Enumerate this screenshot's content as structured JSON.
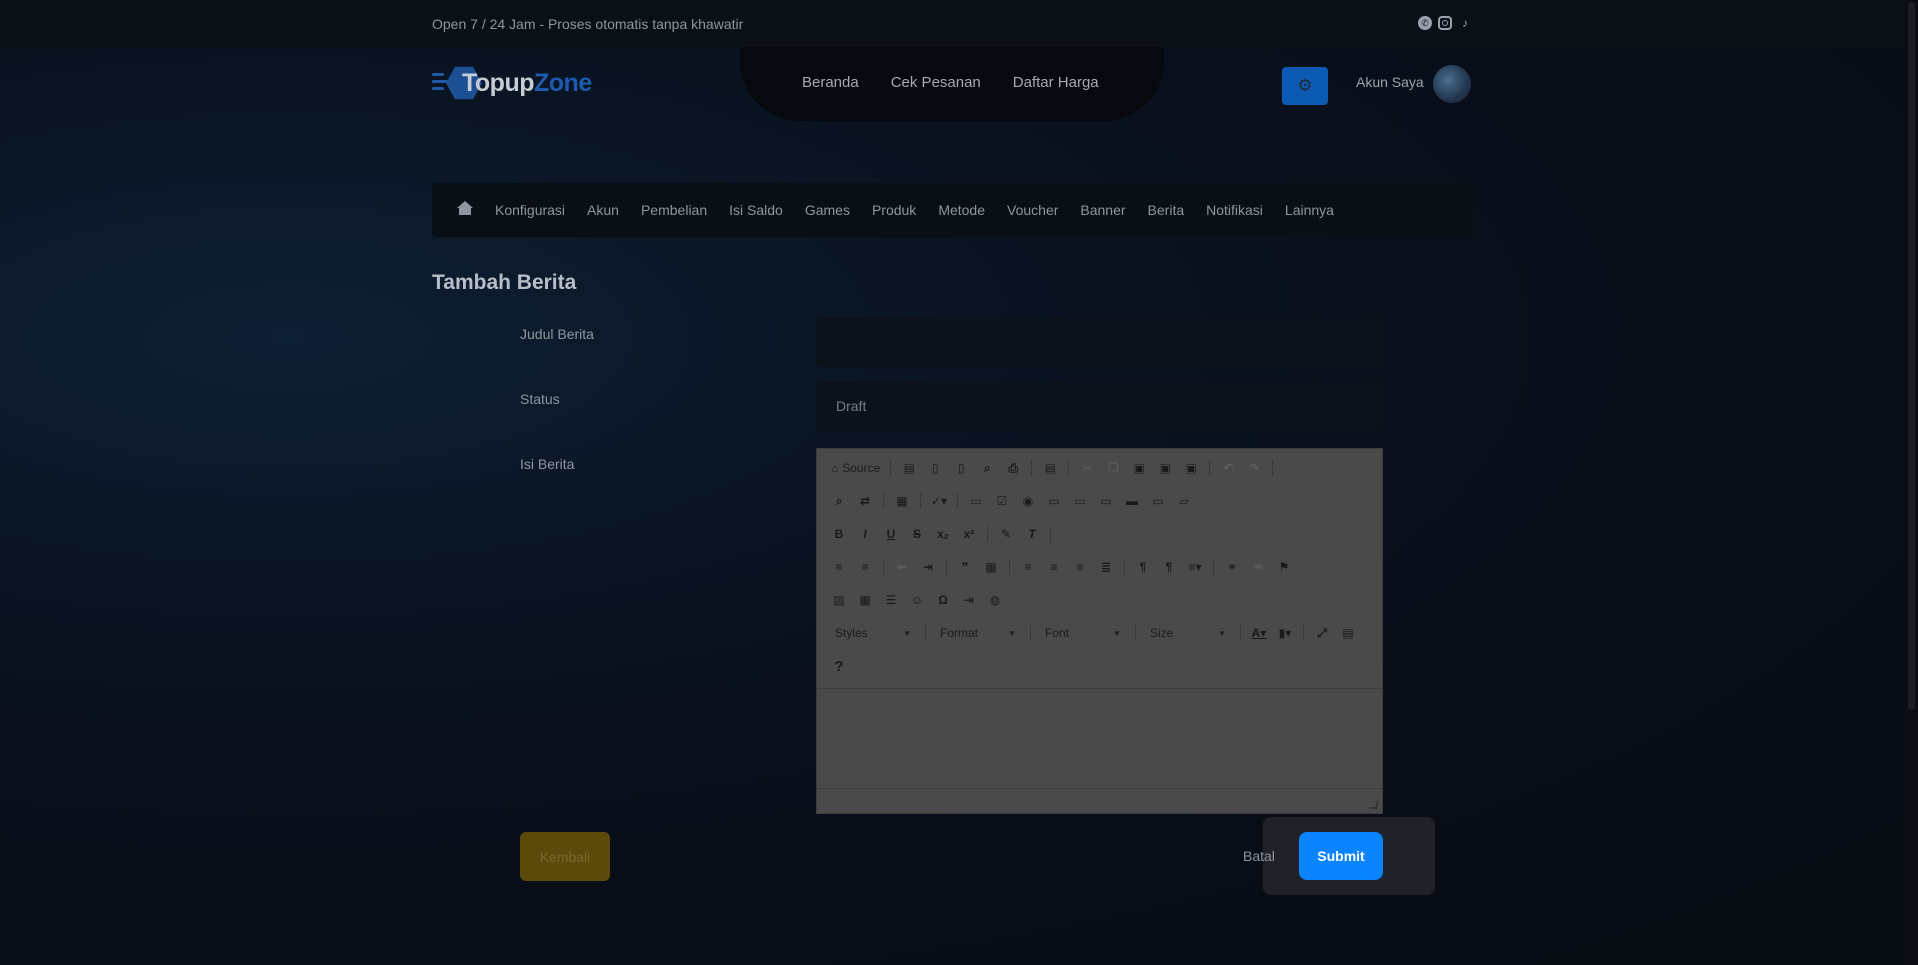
{
  "topbar": {
    "tagline": "Open 7 / 24 Jam - Proses otomatis tanpa khawatir",
    "socials": [
      "whatsapp-icon",
      "instagram-icon",
      "tiktok-icon"
    ]
  },
  "header": {
    "logo_part1": "Topup",
    "logo_part2": "Zone",
    "nav": [
      "Beranda",
      "Cek Pesanan",
      "Daftar Harga"
    ],
    "settings_icon": "gear-icon",
    "account_label": "Akun Saya"
  },
  "admin_menu": {
    "home_icon": "home-icon",
    "items": [
      "Konfigurasi",
      "Akun",
      "Pembelian",
      "Isi Saldo",
      "Games",
      "Produk",
      "Metode",
      "Voucher",
      "Banner",
      "Berita",
      "Notifikasi",
      "Lainnya"
    ]
  },
  "form": {
    "title": "Tambah Berita",
    "judul_label": "Judul Berita",
    "judul_value": "",
    "status_label": "Status",
    "status_value": "Draft",
    "isi_label": "Isi Berita"
  },
  "editor": {
    "source_label": "Source",
    "styles_label": "Styles",
    "format_label": "Format",
    "font_label": "Font",
    "size_label": "Size",
    "help_label": "?"
  },
  "actions": {
    "back_label": "Kembali",
    "cancel_label": "Batal",
    "submit_label": "Submit"
  },
  "colors": {
    "submit": "#0a84ff",
    "back": "#5c4a0b",
    "brand_blue": "#1c5bb0"
  }
}
